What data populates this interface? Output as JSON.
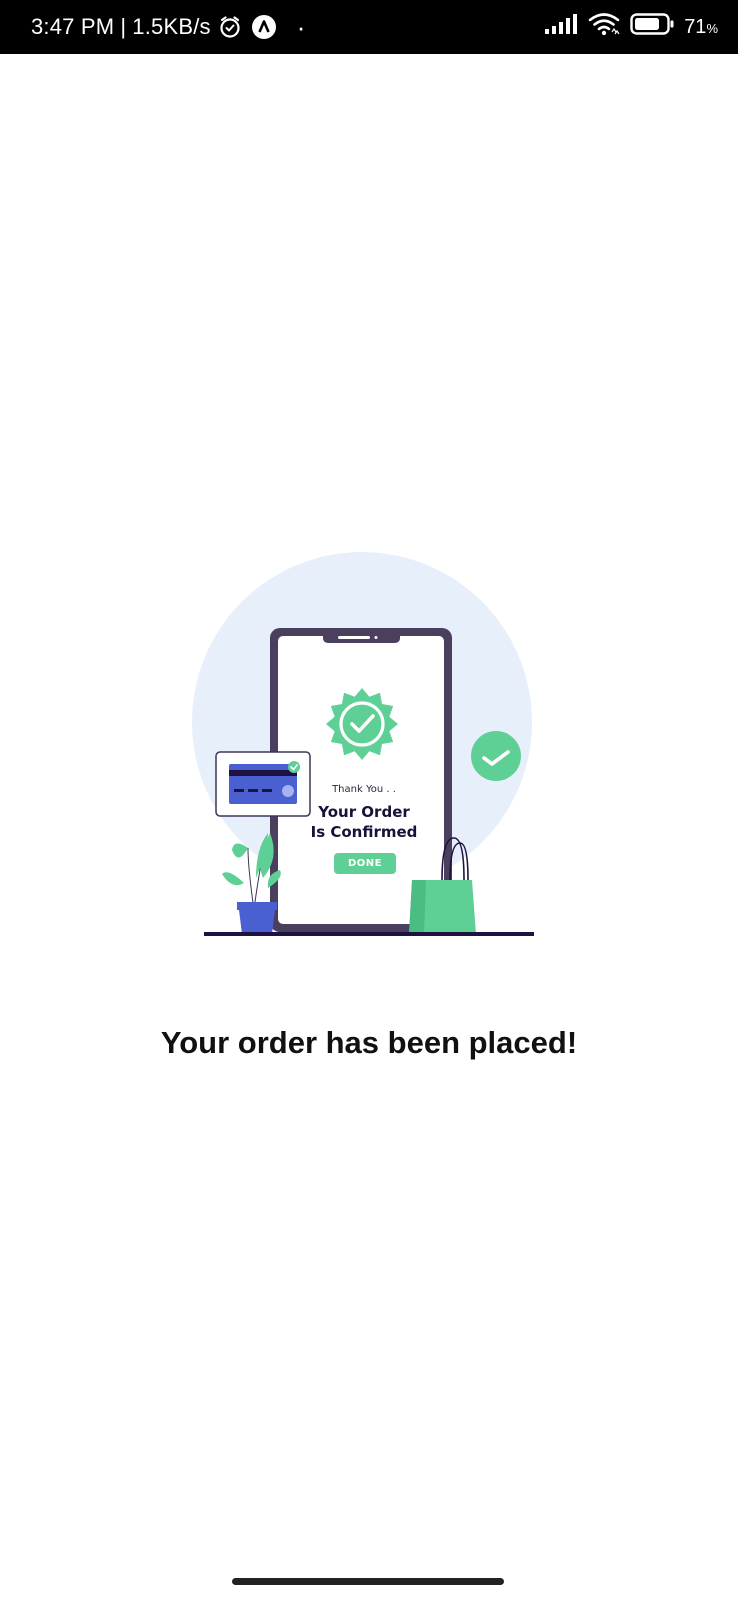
{
  "status_bar": {
    "time": "3:47 PM",
    "separator": "|",
    "network_speed": "1.5KB/s",
    "dot": "·",
    "battery_percent": "71",
    "battery_unit": "%",
    "icons": [
      "alarm-icon",
      "app-notification-icon",
      "signal-icon",
      "wifi-icon",
      "battery-icon"
    ]
  },
  "illustration": {
    "thanks_text": "Thank You . .",
    "heading_line1": "Your Order",
    "heading_line2": "Is Confirmed",
    "done_label": "DONE",
    "colors": {
      "circle": "#e7effb",
      "phone_frame": "#4a3f5c",
      "accent_green": "#5ecf95",
      "card_blue": "#4a5fd0",
      "pot_blue": "#4a5fd0",
      "ground": "#1e1240"
    }
  },
  "message": {
    "text": "Your order has been placed!"
  },
  "colors": {
    "status_bar_bg": "#000000",
    "background": "#ffffff",
    "text": "#111111"
  }
}
